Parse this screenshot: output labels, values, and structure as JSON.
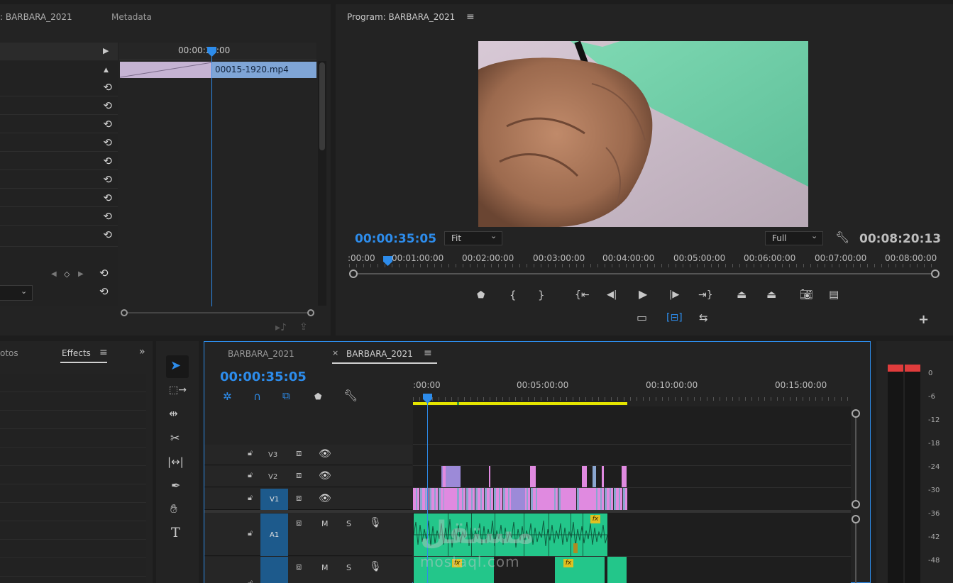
{
  "effect_controls": {
    "tab_title": ": BARBARA_2021",
    "tab_metadata": "Metadata",
    "timecode": "00:00:35:00",
    "clip_name": "00015-1920.mp4"
  },
  "program_monitor": {
    "title": "Program: BARBARA_2021",
    "timecode_current": "00:00:35:05",
    "zoom": "Fit",
    "quality": "Full",
    "timecode_duration": "00:08:20:13",
    "ruler": [
      ":00:00",
      "00:01:00:00",
      "00:02:00:00",
      "00:03:00:00",
      "00:04:00:00",
      "00:05:00:00",
      "00:06:00:00",
      "00:07:00:00",
      "00:08:00:00"
    ]
  },
  "effects_panel": {
    "tab_photos": "otos",
    "tab_effects": "Effects"
  },
  "timeline": {
    "tab1": "BARBARA_2021",
    "tab2": "BARBARA_2021",
    "timecode": "00:00:35:05",
    "ruler": [
      ":00:00",
      "00:05:00:00",
      "00:10:00:00",
      "00:15:00:00"
    ],
    "tracks": {
      "v3": "V3",
      "v2": "V2",
      "v1": "V1",
      "a1": "A1",
      "mute": "M",
      "solo": "S"
    }
  },
  "audio_meter": {
    "scale": [
      "0",
      "-6",
      "-12",
      "-18",
      "-24",
      "-30",
      "-36",
      "-42",
      "-48"
    ]
  },
  "watermark": {
    "arabic": "مستقل",
    "latin": "mostaql.com"
  },
  "colors": {
    "accent_blue": "#2d8ceb",
    "clip_blue": "#8aa6cf",
    "clip_pink": "#e08ae0",
    "clip_violet": "#9c8ad8",
    "audio_green": "#23c68a",
    "work_area": "#e5e500",
    "meter_red": "#e03c3c"
  }
}
